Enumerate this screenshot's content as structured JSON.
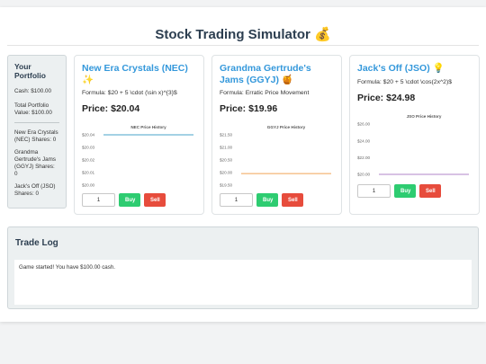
{
  "title": "Stock Trading Simulator 💰",
  "portfolio": {
    "heading": "Your Portfolio",
    "cash": "Cash: $100.00",
    "total": "Total Portfolio Value: $100.00",
    "holdings": [
      "New Era Crystals (NEC) Shares: 0",
      "Grandma Gertrude's Jams (GGYJ) Shares: 0",
      "Jack's Off (JSO) Shares: 0"
    ]
  },
  "stocks": [
    {
      "name": "New Era Crystals (NEC) ✨",
      "formula": "Formula: $20 + 5 \\cdot (\\sin x)^{3}$",
      "price": "Price: $20.04",
      "quantity": "1",
      "buy_label": "Buy",
      "sell_label": "Sell",
      "line_color": "#4aa3c9"
    },
    {
      "name": "Grandma Gertrude's Jams (GGYJ) 🍯",
      "formula": "Formula: Erratic Price Movement",
      "price": "Price: $19.96",
      "quantity": "1",
      "buy_label": "Buy",
      "sell_label": "Sell",
      "line_color": "#f0a356"
    },
    {
      "name": "Jack's Off (JSO) 💡",
      "formula": "Formula: $20 + 5 \\cdot \\cos(2x^2)$",
      "price": "Price: $24.98",
      "quantity": "1",
      "buy_label": "Buy",
      "sell_label": "Sell",
      "line_color": "#b184c9"
    }
  ],
  "chart_data": [
    {
      "type": "line",
      "title": "NEC Price History",
      "yticks": [
        "$20.04",
        "$20.03",
        "$20.02",
        "$20.01",
        "$20.00"
      ],
      "ylim": [
        20.0,
        20.04
      ],
      "series": [
        {
          "values": [
            20.04,
            20.04
          ]
        }
      ]
    },
    {
      "type": "line",
      "title": "GGYJ Price History",
      "yticks": [
        "$21.50",
        "$21.00",
        "$20.50",
        "$20.00",
        "$19.50"
      ],
      "ylim": [
        19.5,
        21.5
      ],
      "series": [
        {
          "values": [
            19.96,
            19.96
          ]
        }
      ]
    },
    {
      "type": "line",
      "title": "JSO Price History",
      "yticks": [
        "$26.00",
        "$24.00",
        "$22.00",
        "$20.00"
      ],
      "ylim": [
        20.0,
        26.0
      ],
      "series": [
        {
          "values": [
            19.96,
            19.96
          ]
        }
      ]
    }
  ],
  "trade_log": {
    "heading": "Trade Log",
    "entries": [
      "Game started! You have $100.00 cash."
    ]
  }
}
